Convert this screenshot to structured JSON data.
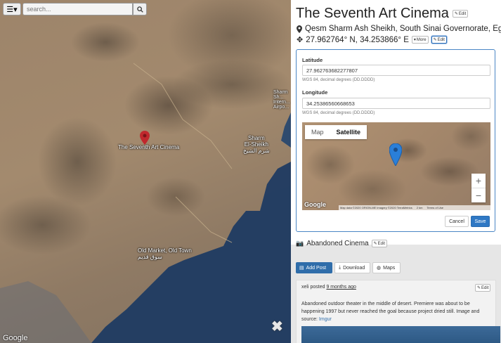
{
  "map": {
    "search_placeholder": "search...",
    "marker_label": "The Seventh Art Cinema",
    "labels": {
      "sharm": "Sharm\nEl-Sheikh\nشرم الشيخ",
      "old_market": "Old Market, Old Town\nسوق قديم",
      "airport": "Sharm\nSh...\nIntern...\nAirpo..."
    },
    "google": "Google",
    "close": "✖"
  },
  "place": {
    "title": "The Seventh Art Cinema",
    "edit_label": "Edit",
    "address": "Qesm Sharm Ash Sheikh, South Sinai Governorate, Egypt",
    "coords": "27.962764° N, 34.253866° E",
    "more_label": "More",
    "coord_edit_label": "Edit"
  },
  "form": {
    "lat_label": "Latitude",
    "lat_value": "27.962763682277807",
    "lat_help": "WGS 84, decimal degrees (DD.DDDD)",
    "lng_label": "Longitude",
    "lng_value": "34.25386560668653",
    "lng_help": "WGS 84, decimal degrees (DD.DDDD)",
    "map_type_map": "Map",
    "map_type_satellite": "Satellite",
    "zoom_in": "+",
    "zoom_out": "−",
    "google": "Google",
    "attribution": "Map data ©2020 ORION-ME Imagery ©2020 TerraMetrics",
    "scale": "2 km",
    "terms": "Terms of Use",
    "cancel_label": "Cancel",
    "save_label": "Save"
  },
  "secondary": {
    "title": "Abandoned Cinema",
    "edit_label": "Edit"
  },
  "actions": {
    "add_post": "Add Post",
    "download": "Download",
    "maps": "Maps"
  },
  "post": {
    "author": "xeli",
    "posted": "posted",
    "time": "9 months ago",
    "edit_label": "Edit",
    "body": "Abandoned outdoor theater in the middle of desert. Premiere was about to be happening 1997 but never reached the goal because project dried still. Image and source:",
    "link": "Imgur"
  },
  "colors": {
    "accent": "#2f78c4",
    "marker": "#c0282d",
    "mini_marker": "#2a7fd9"
  }
}
